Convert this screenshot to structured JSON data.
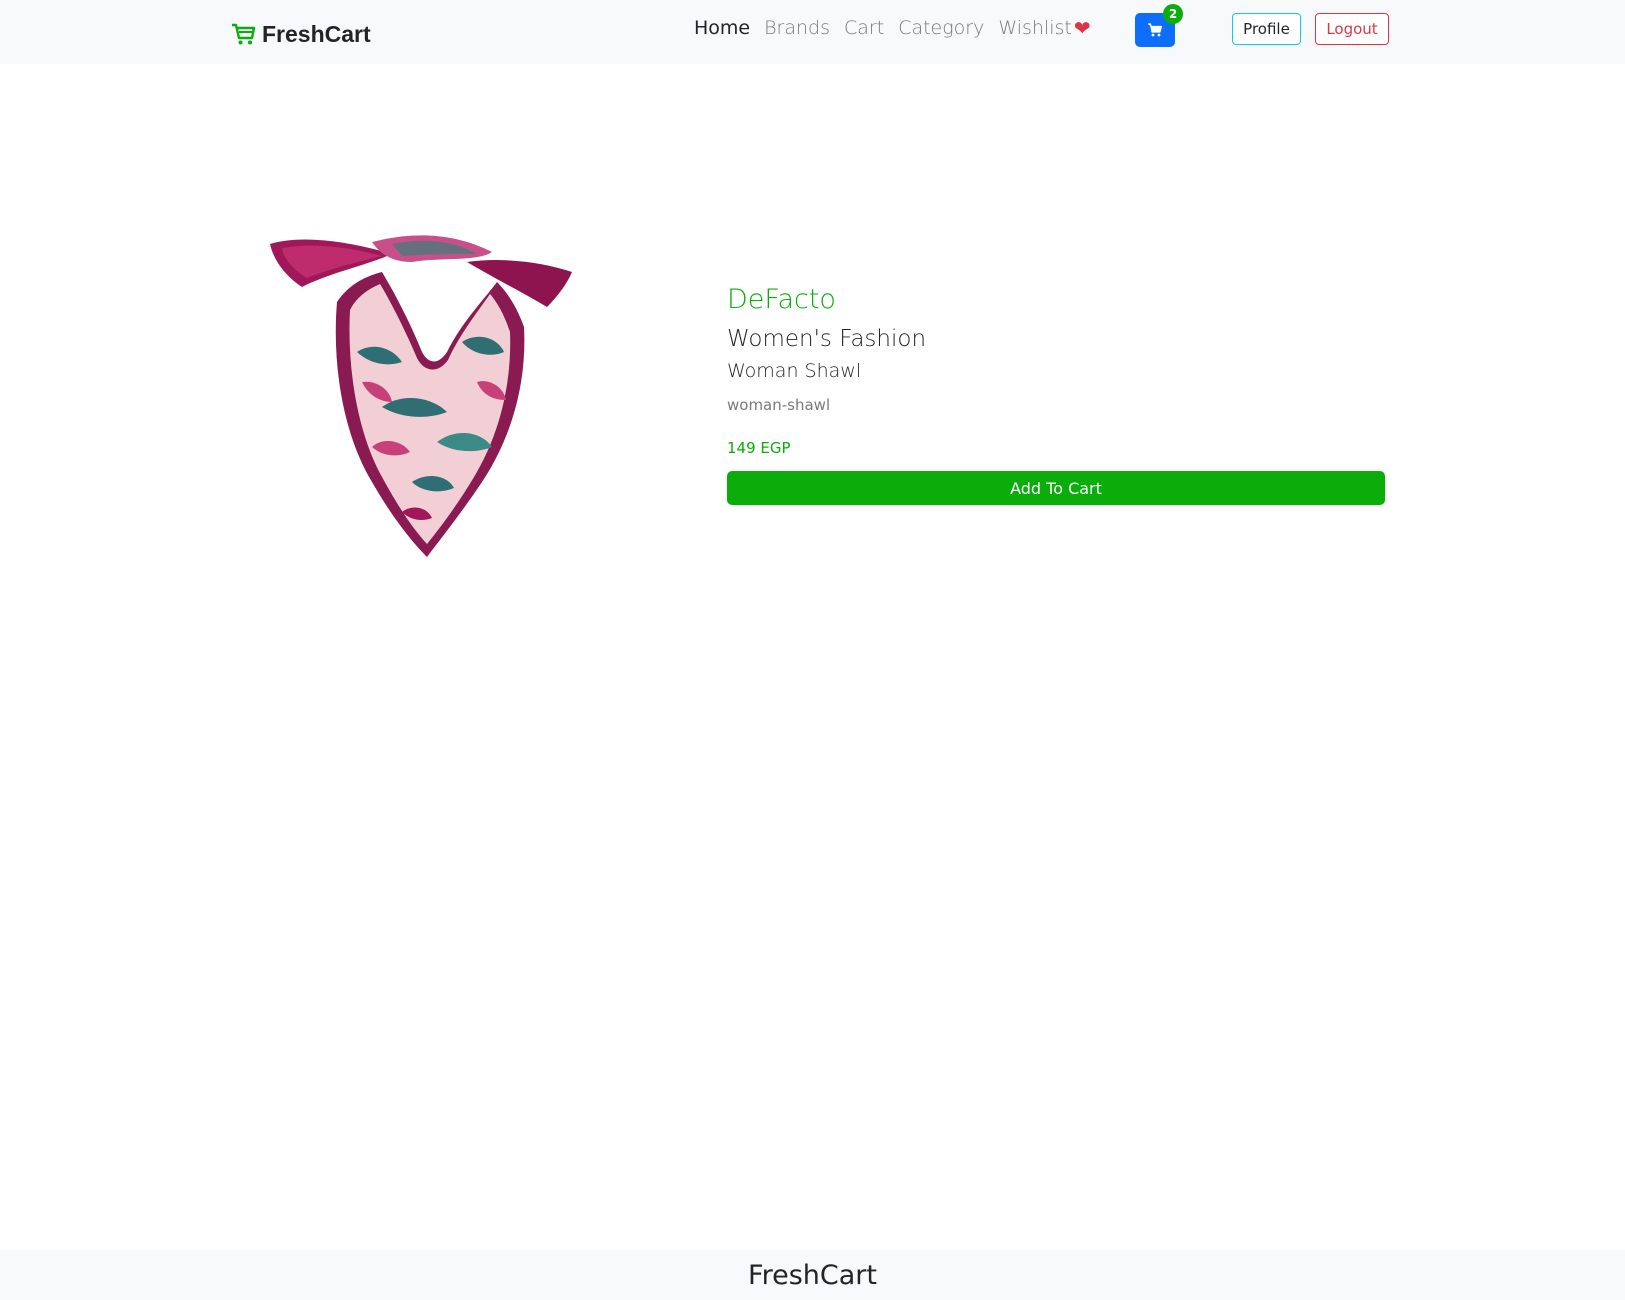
{
  "navbar": {
    "brand": "FreshCart",
    "links": [
      {
        "label": "Home",
        "active": true
      },
      {
        "label": "Brands",
        "active": false
      },
      {
        "label": "Cart",
        "active": false
      },
      {
        "label": "Category",
        "active": false
      },
      {
        "label": "Wishlist",
        "active": false
      }
    ],
    "wishlist_icon": "heart-icon",
    "cart_button_icon": "shopping-cart-icon",
    "cart_count": "2",
    "profile_label": "Profile",
    "logout_label": "Logout"
  },
  "product": {
    "image_name": "woman-shawl-image",
    "brand": "DeFacto",
    "category": "Women's Fashion",
    "title": "Woman Shawl",
    "slug": "woman-shawl",
    "price": "149 EGP",
    "add_to_cart_label": "Add To Cart"
  },
  "footer": {
    "brand": "FreshCart"
  },
  "colors": {
    "accent_green": "#0aad0a",
    "primary_blue": "#0d6efd",
    "danger_red": "#dc3545",
    "info_cyan": "#0dcaf0",
    "navbar_bg": "#f8f9fa"
  }
}
